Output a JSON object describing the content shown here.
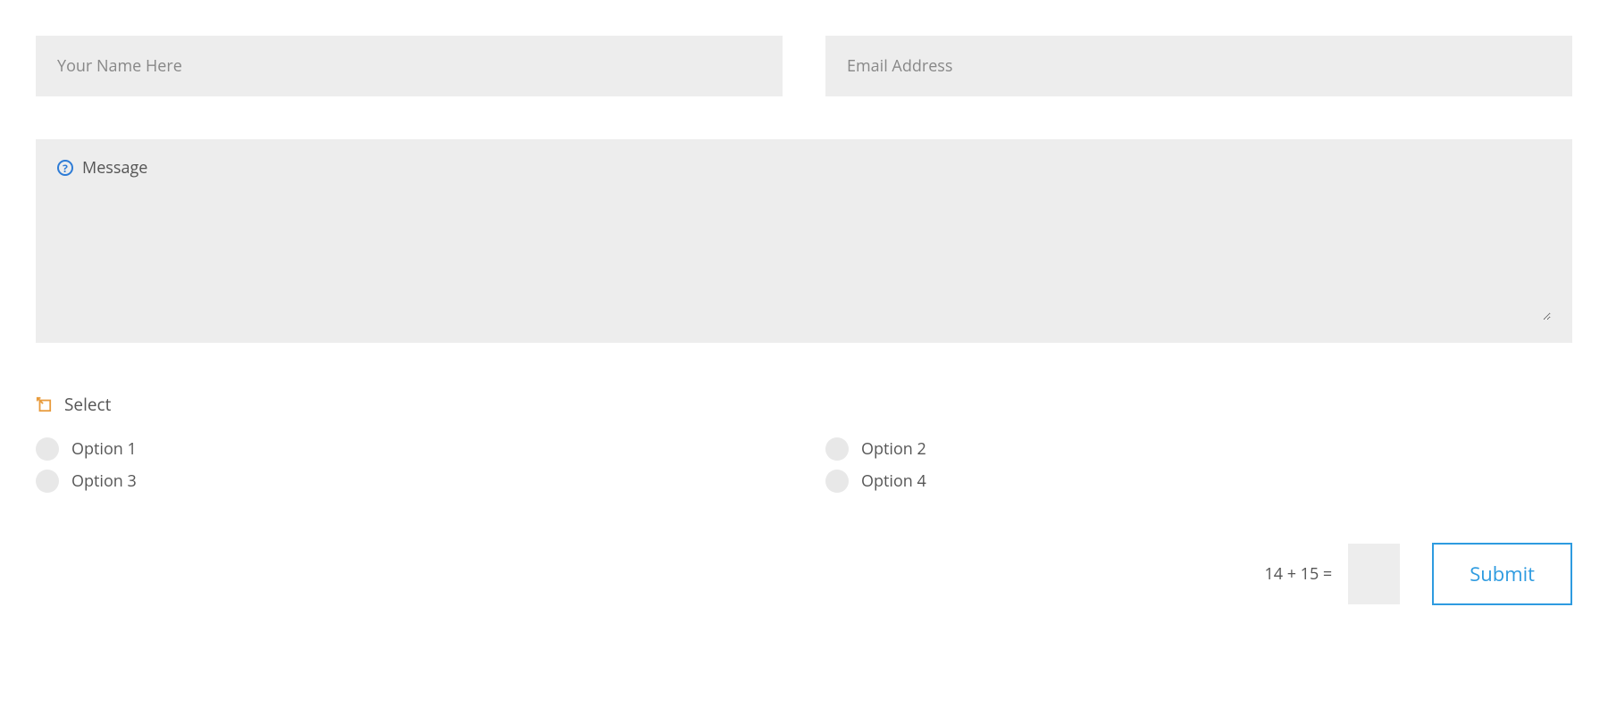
{
  "form": {
    "name": {
      "placeholder": "Your Name Here",
      "value": ""
    },
    "email": {
      "placeholder": "Email Address",
      "value": ""
    },
    "message": {
      "label": "Message",
      "value": ""
    },
    "select": {
      "label": "Select",
      "options": [
        "Option 1",
        "Option 2",
        "Option 3",
        "Option 4"
      ]
    },
    "captcha": {
      "question": "14 + 15 =",
      "value": ""
    },
    "submit": {
      "label": "Submit"
    }
  },
  "colors": {
    "accent": "#2e9be0",
    "helpIcon": "#2e7cd6",
    "selectIcon": "#e89b3c",
    "inputBg": "#ededed",
    "text": "#555"
  }
}
